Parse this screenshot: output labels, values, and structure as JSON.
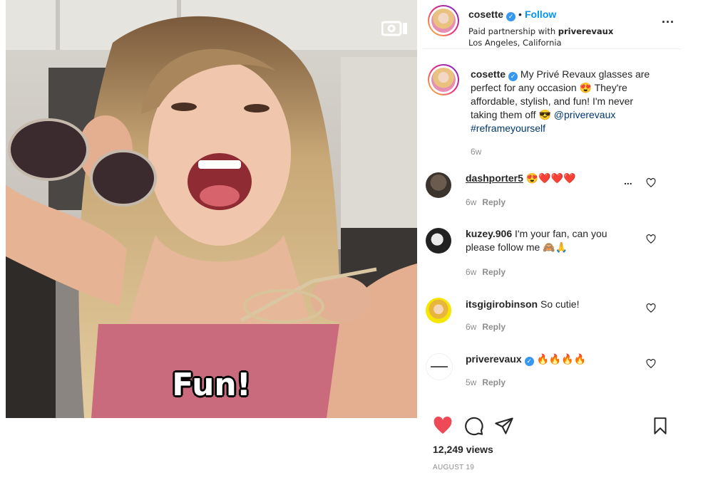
{
  "media": {
    "overlay_caption": "Fun!",
    "video_indicator_icon": "video-camera-icon"
  },
  "header": {
    "username": "cosette",
    "verified_icon": "verified-badge-icon",
    "separator": "•",
    "follow_label": "Follow",
    "partnership_prefix": "Paid partnership with ",
    "partner": "priverevaux",
    "location": "Los Angeles, California",
    "more_icon": "more-horizontal-icon",
    "more_label": "..."
  },
  "caption": {
    "username": "cosette",
    "text": "My Privé Revaux glasses are perfect for any occasion 😍 They're affordable, stylish, and fun! I'm never taking them off 😎",
    "mention": "@priverevaux",
    "hashtag": "#reframeyourself",
    "time": "6w"
  },
  "comments": [
    {
      "username": "dashporter5",
      "text": "😍❤️❤️❤️",
      "time": "6w",
      "reply": "Reply",
      "more": "..."
    },
    {
      "username": "kuzey.906",
      "text": "I'm your fan, can you please follow me 🙈🙏",
      "time": "6w",
      "reply": "Reply"
    },
    {
      "username": "itsgigirobinson",
      "text": "So cutie!",
      "time": "6w",
      "reply": "Reply"
    },
    {
      "username": "priverevaux",
      "text": "🔥🔥🔥🔥",
      "time": "5w",
      "reply": "Reply",
      "verified": true
    }
  ],
  "actions": {
    "like_icon": "heart-filled-icon",
    "comment_icon": "comment-bubble-icon",
    "share_icon": "paper-plane-icon",
    "save_icon": "bookmark-icon",
    "like_color": "#ed4956"
  },
  "views": "12,249 views",
  "date": "AUGUST 19"
}
